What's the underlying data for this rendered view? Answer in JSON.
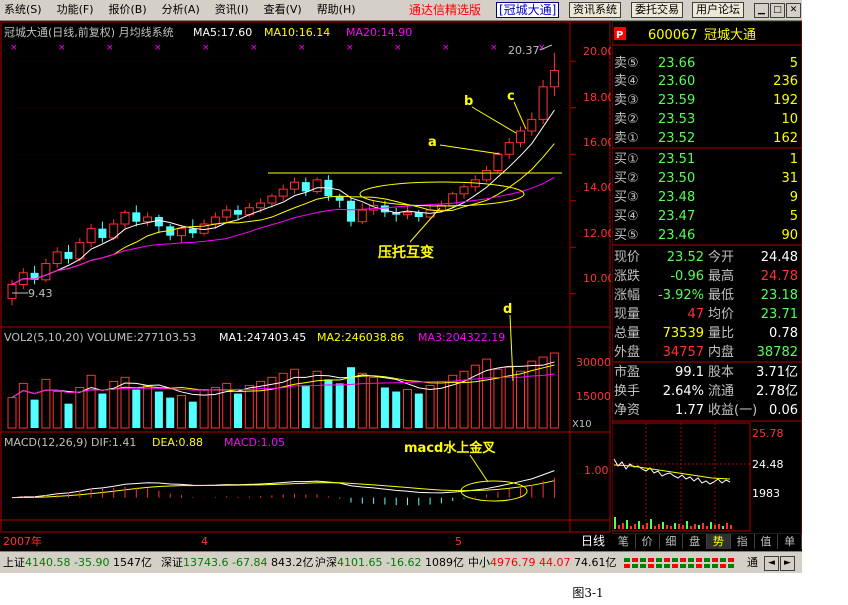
{
  "menu": {
    "items": [
      "系统(S)",
      "功能(F)",
      "报价(B)",
      "分析(A)",
      "资讯(I)",
      "查看(V)",
      "帮助(H)"
    ],
    "brand": "通达信精选版",
    "stock": "[冠城大通]",
    "buttons": [
      "资讯系统",
      "委托交易",
      "用户论坛"
    ]
  },
  "chart": {
    "title_line": "冠城大通(日线,前复权) 月均线系统",
    "ma5": "MA5:17.60",
    "ma10": "MA10:16.14",
    "ma20": "MA20:14.90",
    "y_ticks": [
      "20.00",
      "18.00",
      "16.00",
      "14.00",
      "12.00",
      "10.00"
    ],
    "high_label": "20.37",
    "low_label": "9.43",
    "annotation_a": "a",
    "annotation_b": "b",
    "annotation_c": "c",
    "annotation_d": "d",
    "annotation_main": "压托互变",
    "annotation_macd": "macd水上金叉",
    "vol_title": "VOL2(5,10,20) VOLUME:277103.53",
    "vol_ma1": "MA1:247403.45",
    "vol_ma2": "MA2:246038.86",
    "vol_ma3": "MA3:204322.19",
    "vol_ticks": [
      "30000",
      "15000"
    ],
    "vol_unit": "X10",
    "macd_title": "MACD(12,26,9) DIF:1.41",
    "macd_dea": "DEA:0.88",
    "macd_macd": "MACD:1.05",
    "macd_tick": "1.00",
    "x_labels": [
      "2007年",
      "4",
      "5"
    ],
    "period_label": "日线"
  },
  "chart_data": {
    "type": "candlestick",
    "price_range": [
      9,
      20.7
    ],
    "candles": [
      [
        9.8,
        10.4,
        9.5,
        10.6
      ],
      [
        10.4,
        10.9,
        10.2,
        11.1
      ],
      [
        10.9,
        10.6,
        10.4,
        11.2
      ],
      [
        10.6,
        11.3,
        10.5,
        11.5
      ],
      [
        11.3,
        11.8,
        11.1,
        12.0
      ],
      [
        11.8,
        11.5,
        11.3,
        12.1
      ],
      [
        11.5,
        12.2,
        11.4,
        12.4
      ],
      [
        12.2,
        12.8,
        12.0,
        13.0
      ],
      [
        12.8,
        12.4,
        12.2,
        13.1
      ],
      [
        12.4,
        13.0,
        12.3,
        13.2
      ],
      [
        13.0,
        13.5,
        12.8,
        13.6
      ],
      [
        13.5,
        13.1,
        12.9,
        13.8
      ],
      [
        13.1,
        13.3,
        12.9,
        13.5
      ],
      [
        13.3,
        12.9,
        12.6,
        13.4
      ],
      [
        12.9,
        12.5,
        12.3,
        13.0
      ],
      [
        12.5,
        12.8,
        12.2,
        12.9
      ],
      [
        12.8,
        12.6,
        12.4,
        13.2
      ],
      [
        12.6,
        13.0,
        12.5,
        13.2
      ],
      [
        13.0,
        13.3,
        12.8,
        13.5
      ],
      [
        13.3,
        13.6,
        13.1,
        13.8
      ],
      [
        13.6,
        13.4,
        13.2,
        13.8
      ],
      [
        13.4,
        13.7,
        13.3,
        13.9
      ],
      [
        13.7,
        13.9,
        13.5,
        14.1
      ],
      [
        13.9,
        14.2,
        13.7,
        14.3
      ],
      [
        14.2,
        14.5,
        14.0,
        14.7
      ],
      [
        14.5,
        14.8,
        14.3,
        15.0
      ],
      [
        14.8,
        14.4,
        14.2,
        15.0
      ],
      [
        14.4,
        14.9,
        14.3,
        15.0
      ],
      [
        14.9,
        14.2,
        14.0,
        15.1
      ],
      [
        14.2,
        14.0,
        13.7,
        14.3
      ],
      [
        14.0,
        13.1,
        12.9,
        14.1
      ],
      [
        13.1,
        13.6,
        13.0,
        13.9
      ],
      [
        13.6,
        13.8,
        13.4,
        14.0
      ],
      [
        13.8,
        13.5,
        13.3,
        14.0
      ],
      [
        13.5,
        13.4,
        13.1,
        13.7
      ],
      [
        13.4,
        13.5,
        13.2,
        13.8
      ],
      [
        13.5,
        13.3,
        13.1,
        13.6
      ],
      [
        13.3,
        13.6,
        13.2,
        13.8
      ],
      [
        13.6,
        13.8,
        13.5,
        14.0
      ],
      [
        13.8,
        14.3,
        13.7,
        14.4
      ],
      [
        14.3,
        14.6,
        14.1,
        14.7
      ],
      [
        14.6,
        14.9,
        14.4,
        15.1
      ],
      [
        14.9,
        15.3,
        14.8,
        15.5
      ],
      [
        15.3,
        16.0,
        15.2,
        16.1
      ],
      [
        16.0,
        16.5,
        15.8,
        16.7
      ],
      [
        16.5,
        17.0,
        16.3,
        17.2
      ],
      [
        17.0,
        17.5,
        16.8,
        17.8
      ],
      [
        17.5,
        18.9,
        17.3,
        19.2
      ],
      [
        18.9,
        19.6,
        18.5,
        20.37
      ]
    ],
    "volume_range": [
      0,
      38000
    ],
    "volumes": [
      [
        15000,
        0
      ],
      [
        22000,
        0
      ],
      [
        14000,
        1
      ],
      [
        24000,
        0
      ],
      [
        18000,
        0
      ],
      [
        12000,
        1
      ],
      [
        20000,
        0
      ],
      [
        26000,
        0
      ],
      [
        17000,
        1
      ],
      [
        23000,
        0
      ],
      [
        25000,
        0
      ],
      [
        19000,
        1
      ],
      [
        21000,
        0
      ],
      [
        18000,
        1
      ],
      [
        15000,
        1
      ],
      [
        16000,
        0
      ],
      [
        13000,
        1
      ],
      [
        19000,
        0
      ],
      [
        20000,
        0
      ],
      [
        22000,
        0
      ],
      [
        17000,
        1
      ],
      [
        21000,
        0
      ],
      [
        23000,
        0
      ],
      [
        25000,
        0
      ],
      [
        27000,
        0
      ],
      [
        29000,
        0
      ],
      [
        21000,
        1
      ],
      [
        28000,
        0
      ],
      [
        24000,
        1
      ],
      [
        22000,
        1
      ],
      [
        30000,
        1
      ],
      [
        27000,
        0
      ],
      [
        25000,
        0
      ],
      [
        20000,
        1
      ],
      [
        18000,
        1
      ],
      [
        19000,
        0
      ],
      [
        17000,
        1
      ],
      [
        21000,
        0
      ],
      [
        23000,
        0
      ],
      [
        26000,
        0
      ],
      [
        28000,
        0
      ],
      [
        31000,
        0
      ],
      [
        34000,
        0
      ],
      [
        29000,
        0
      ],
      [
        30000,
        0
      ],
      [
        28000,
        0
      ],
      [
        33000,
        0
      ],
      [
        35000,
        0
      ],
      [
        37000,
        0
      ]
    ],
    "macd_range": [
      -1.0,
      2.2
    ]
  },
  "quote": {
    "code": "600067",
    "name": "冠城大通",
    "sell": [
      {
        "label": "卖⑤",
        "price": "23.66",
        "vol": "5"
      },
      {
        "label": "卖④",
        "price": "23.60",
        "vol": "236"
      },
      {
        "label": "卖③",
        "price": "23.59",
        "vol": "192"
      },
      {
        "label": "卖②",
        "price": "23.53",
        "vol": "10"
      },
      {
        "label": "卖①",
        "price": "23.52",
        "vol": "162"
      }
    ],
    "buy": [
      {
        "label": "买①",
        "price": "23.51",
        "vol": "1"
      },
      {
        "label": "买②",
        "price": "23.50",
        "vol": "31"
      },
      {
        "label": "买③",
        "price": "23.48",
        "vol": "9"
      },
      {
        "label": "买④",
        "price": "23.47",
        "vol": "5"
      },
      {
        "label": "买⑤",
        "price": "23.46",
        "vol": "90"
      }
    ],
    "stats": [
      [
        "现价",
        "23.52",
        "今开",
        "24.48"
      ],
      [
        "涨跌",
        "-0.96",
        "最高",
        "24.78"
      ],
      [
        "涨幅",
        "-3.92%",
        "最低",
        "23.18"
      ],
      [
        "现量",
        "47",
        "均价",
        "23.71"
      ],
      [
        "总量",
        "73539",
        "量比",
        "0.78"
      ],
      [
        "外盘",
        "34757",
        "内盘",
        "38782"
      ],
      [
        "市盈",
        "99.1",
        "股本",
        "3.71亿"
      ],
      [
        "换手",
        "2.64%",
        "流通",
        "2.78亿"
      ],
      [
        "净资",
        "1.77",
        "收益(一)",
        "0.06"
      ]
    ],
    "mini_top": "25.78",
    "mini_mid": "24.48",
    "mini_vol": "1983"
  },
  "tabs": [
    "笔",
    "价",
    "细",
    "盘",
    "势",
    "指",
    "值",
    "单"
  ],
  "active_tab": "势",
  "status": {
    "sh_label": "上证",
    "sh_val": "4140.58",
    "sh_chg": "-35.90",
    "sh_amt": "1547亿",
    "sz_label": "深证",
    "sz_val": "13743.6",
    "sz_chg": "-67.84",
    "sz_amt": "843.2亿",
    "hs_label": "沪深",
    "hs_val": "4101.65",
    "hs_chg": "-16.62",
    "hs_amt": "1089亿",
    "zx_label": "中小",
    "zx_val": "4976.79",
    "zx_chg": "44.07",
    "zx_amt": "74.61亿",
    "end_label": "通"
  },
  "caption": "图3-1",
  "colors": {
    "up": "#ff3232",
    "down": "#54ffff",
    "ma5": "#ffffff",
    "ma10": "#ffff00",
    "ma20": "#ff00ff",
    "axis": "#b00000"
  }
}
